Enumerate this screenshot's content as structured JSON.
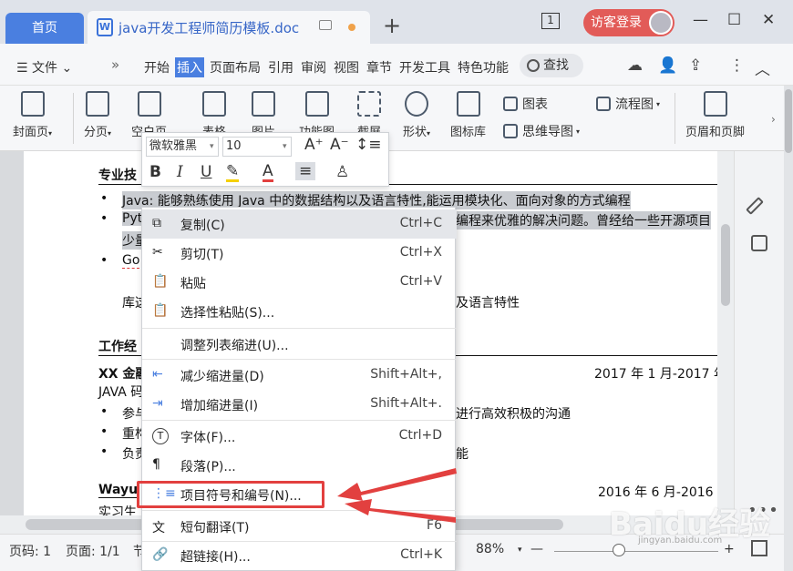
{
  "titlebar": {
    "home_tab": "首页",
    "doc_tab": "java开发工程师简历模板.doc",
    "doc_icon": "W",
    "window_count": "1",
    "login_button": "访客登录"
  },
  "menubar": {
    "file": "文件",
    "tabs": [
      "开始",
      "插入",
      "页面布局",
      "引用",
      "审阅",
      "视图",
      "章节",
      "开发工具",
      "特色功能"
    ],
    "active_tab": "插入",
    "search": "查找"
  },
  "ribbon": {
    "cover_page": "封面页",
    "page_break": "分页",
    "blank_page": "空白页",
    "table": "表格",
    "picture": "图片",
    "shape_map": "功能图",
    "screenshot": "截屏",
    "shapes": "形状",
    "icon_library": "图标库",
    "chart": "图表",
    "flowchart": "流程图",
    "mindmap": "思维导图",
    "header_footer": "页眉和页脚"
  },
  "minibar": {
    "font": "微软雅黑",
    "size": "10"
  },
  "document": {
    "section_skills": "专业技",
    "skill_java": "Java: 能够熟练使用 Java 中的数据结构以及语言特性,能运用模块化、面向对象的方式编程",
    "skill_py_start": "Pyt",
    "skill_py_end": "编程来优雅的解决问题。曾经给一些开源项目",
    "skill_py_line2": "少量",
    "skill_go": "Go",
    "skill_lib_start": "库这",
    "skill_lib_end": "及语言特性",
    "section_work": "工作经",
    "job1_company": "XX 金融",
    "job1_date": "2017 年 1 月-2017 年",
    "job1_role": "JAVA 码",
    "job1_b1_start": "参与",
    "job1_b1_end": "进行高效积极的沟通",
    "job1_b2": "重构",
    "job1_b3_start": "负责",
    "job1_b3_end": "能",
    "job2_company": "Wayu",
    "job2_date": "2016 年 6 月-2016 年",
    "job2_role": "实习生"
  },
  "context_menu": [
    {
      "label": "复制(C)",
      "shortcut": "Ctrl+C",
      "icon": "copy-icon"
    },
    {
      "label": "剪切(T)",
      "shortcut": "Ctrl+X",
      "icon": "cut-icon"
    },
    {
      "label": "粘贴",
      "shortcut": "Ctrl+V",
      "icon": "paste-icon"
    },
    {
      "label": "选择性粘贴(S)...",
      "shortcut": "",
      "icon": "paste-special-icon"
    },
    {
      "label": "调整列表缩进(U)...",
      "shortcut": "",
      "icon": ""
    },
    {
      "label": "减少缩进量(D)",
      "shortcut": "Shift+Alt+,",
      "icon": "decrease-indent-icon"
    },
    {
      "label": "增加缩进量(I)",
      "shortcut": "Shift+Alt+.",
      "icon": "increase-indent-icon"
    },
    {
      "label": "字体(F)...",
      "shortcut": "Ctrl+D",
      "icon": "font-icon"
    },
    {
      "label": "段落(P)...",
      "shortcut": "",
      "icon": "paragraph-icon"
    },
    {
      "label": "项目符号和编号(N)...",
      "shortcut": "",
      "icon": "bullets-numbering-icon"
    },
    {
      "label": "短句翻译(T)",
      "shortcut": "F6",
      "icon": "translate-icon"
    },
    {
      "label": "超链接(H)...",
      "shortcut": "Ctrl+K",
      "icon": "hyperlink-icon"
    }
  ],
  "statusbar": {
    "page_num": "页码: 1",
    "pages": "页面: 1/1",
    "section": "节",
    "zoom": "88%"
  },
  "watermark": "Baidu经验",
  "watermark_url": "jingyan.baidu.com",
  "colors": {
    "accent": "#4a7fe0",
    "login": "#e25b58",
    "annotation": "#e2403f"
  }
}
